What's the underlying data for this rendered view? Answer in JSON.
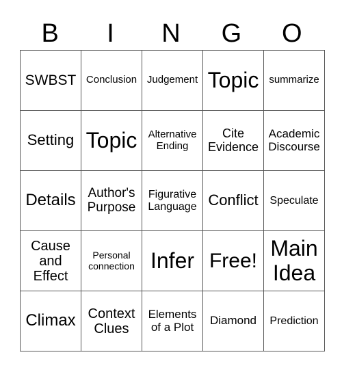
{
  "header": [
    "B",
    "I",
    "N",
    "G",
    "O"
  ],
  "rows": [
    [
      "SWBST",
      "Conclusion",
      "Judgement",
      "Topic",
      "summarize"
    ],
    [
      "Setting",
      "Topic",
      "Alternative Ending",
      "Cite Evidence",
      "Academic Discourse"
    ],
    [
      "Details",
      "Author's Purpose",
      "Figurative Language",
      "Conflict",
      "Speculate"
    ],
    [
      "Cause and Effect",
      "Personal connection",
      "Infer",
      "Free!",
      "Main Idea"
    ],
    [
      "Climax",
      "Context Clues",
      "Elements of a Plot",
      "Diamond",
      "Prediction"
    ]
  ]
}
